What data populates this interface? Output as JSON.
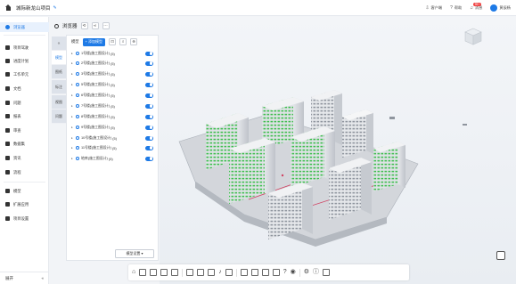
{
  "header": {
    "project_title": "城际新龙山项目",
    "right_items": [
      {
        "label": "客户端",
        "icon": "download-icon"
      },
      {
        "label": "帮助",
        "icon": "help-icon"
      },
      {
        "label": "消息",
        "icon": "bell-icon",
        "badge": "99+"
      },
      {
        "label": "黄辰杨",
        "icon": "avatar"
      }
    ]
  },
  "sidebar": {
    "items": [
      {
        "label": "浏览器",
        "icon": "browser-icon",
        "active": true
      },
      {
        "label": "项目驾驶",
        "icon": "dashboard-icon"
      },
      {
        "label": "进度计划",
        "icon": "calendar-icon"
      },
      {
        "label": "工作单元",
        "icon": "workunit-icon"
      },
      {
        "label": "文档",
        "icon": "document-icon"
      },
      {
        "label": "问题",
        "icon": "issue-icon"
      },
      {
        "label": "报表",
        "icon": "report-icon"
      },
      {
        "label": "审查",
        "icon": "review-icon"
      },
      {
        "label": "数据集",
        "icon": "dataset-icon"
      },
      {
        "label": "资讯",
        "icon": "news-icon"
      },
      {
        "label": "流程",
        "icon": "workflow-icon"
      },
      {
        "label": "模型",
        "icon": "model-icon"
      },
      {
        "label": "扩展应用",
        "icon": "extension-icon"
      },
      {
        "label": "项目设置",
        "icon": "settings-icon"
      }
    ],
    "footer_label": "展开"
  },
  "browser": {
    "title": "浏览器",
    "tabs": [
      "模型",
      "图纸",
      "标注",
      "视图",
      "问题"
    ],
    "collapse_glyph": "«"
  },
  "model_panel": {
    "label": "模型",
    "add_button": "+ 添加模型",
    "rows": [
      {
        "name": "1号楼(施工图设计)",
        "count": "(5)"
      },
      {
        "name": "2号楼(施工图设计)",
        "count": "(5)"
      },
      {
        "name": "3号楼(施工图设计)",
        "count": "(5)"
      },
      {
        "name": "5号楼(施工图设计)",
        "count": "(5)"
      },
      {
        "name": "6号楼(施工图设计)",
        "count": "(5)"
      },
      {
        "name": "7号楼(施工图设计)",
        "count": "(5)"
      },
      {
        "name": "8号楼(施工图设计)",
        "count": "(5)"
      },
      {
        "name": "9号楼(施工图设计)",
        "count": "(5)"
      },
      {
        "name": "10号楼(施工图设计)",
        "count": "(5)"
      },
      {
        "name": "11号楼(施工图设计)",
        "count": "(5)"
      },
      {
        "name": "地库(施工图设计)",
        "count": "(5)"
      }
    ],
    "bottom_button": "模型设置 ▾"
  },
  "colors": {
    "accent": "#1e7ae6",
    "building_green": "#3fbf4f",
    "sidebar_active_bg": "#e8f1fd"
  }
}
